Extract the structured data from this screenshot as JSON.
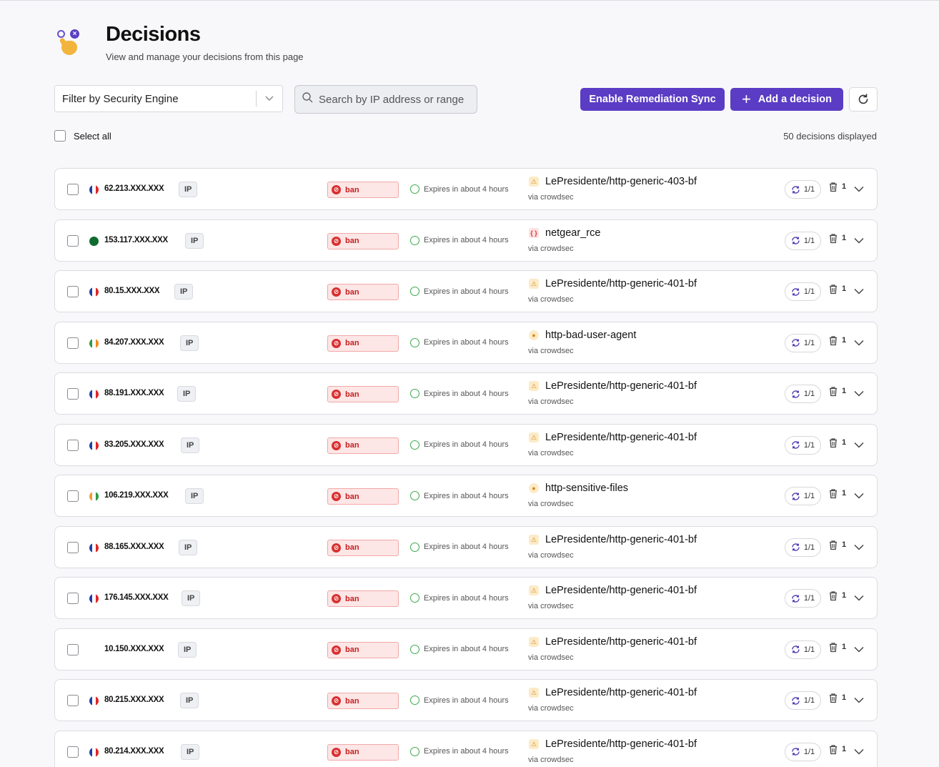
{
  "page": {
    "title": "Decisions",
    "subtitle": "View and manage your decisions from this page"
  },
  "toolbar": {
    "filter_label": "Filter by Security Engine",
    "search_placeholder": "Search by IP address or range",
    "sync_label": "Enable Remediation Sync",
    "add_label": "Add a decision"
  },
  "list": {
    "select_all_label": "Select all",
    "count_label": "50 decisions displayed"
  },
  "colors": {
    "accent": "#5b3cc4",
    "ban_bg": "#fde6e6",
    "ban_text": "#c42020",
    "expires_ring": "#3aaa4a"
  },
  "decisions": [
    {
      "country": "fr",
      "ip": "62.213.XXX.XXX",
      "type": "IP",
      "action": "ban",
      "expires": "Expires in about 4 hours",
      "scenario_icon": "bf",
      "scenario": "LePresidente/http-generic-403-bf",
      "via": "via crowdsec",
      "sync": "1/1",
      "count": "1"
    },
    {
      "country": "pk",
      "ip": "153.117.XXX.XXX",
      "type": "IP",
      "action": "ban",
      "expires": "Expires in about 4 hours",
      "scenario_icon": "rce",
      "scenario": "netgear_rce",
      "via": "via crowdsec",
      "sync": "1/1",
      "count": "1"
    },
    {
      "country": "fr",
      "ip": "80.15.XXX.XXX",
      "type": "IP",
      "action": "ban",
      "expires": "Expires in about 4 hours",
      "scenario_icon": "bf",
      "scenario": "LePresidente/http-generic-401-bf",
      "via": "via crowdsec",
      "sync": "1/1",
      "count": "1"
    },
    {
      "country": "ie",
      "ip": "84.207.XXX.XXX",
      "type": "IP",
      "action": "ban",
      "expires": "Expires in about 4 hours",
      "scenario_icon": "ua",
      "scenario": "http-bad-user-agent",
      "via": "via crowdsec",
      "sync": "1/1",
      "count": "1"
    },
    {
      "country": "fr",
      "ip": "88.191.XXX.XXX",
      "type": "IP",
      "action": "ban",
      "expires": "Expires in about 4 hours",
      "scenario_icon": "bf",
      "scenario": "LePresidente/http-generic-401-bf",
      "via": "via crowdsec",
      "sync": "1/1",
      "count": "1"
    },
    {
      "country": "fr",
      "ip": "83.205.XXX.XXX",
      "type": "IP",
      "action": "ban",
      "expires": "Expires in about 4 hours",
      "scenario_icon": "bf",
      "scenario": "LePresidente/http-generic-401-bf",
      "via": "via crowdsec",
      "sync": "1/1",
      "count": "1"
    },
    {
      "country": "in",
      "ip": "106.219.XXX.XXX",
      "type": "IP",
      "action": "ban",
      "expires": "Expires in about 4 hours",
      "scenario_icon": "ua",
      "scenario": "http-sensitive-files",
      "via": "via crowdsec",
      "sync": "1/1",
      "count": "1"
    },
    {
      "country": "fr",
      "ip": "88.165.XXX.XXX",
      "type": "IP",
      "action": "ban",
      "expires": "Expires in about 4 hours",
      "scenario_icon": "bf",
      "scenario": "LePresidente/http-generic-401-bf",
      "via": "via crowdsec",
      "sync": "1/1",
      "count": "1"
    },
    {
      "country": "fr",
      "ip": "176.145.XXX.XXX",
      "type": "IP",
      "action": "ban",
      "expires": "Expires in about 4 hours",
      "scenario_icon": "bf",
      "scenario": "LePresidente/http-generic-401-bf",
      "via": "via crowdsec",
      "sync": "1/1",
      "count": "1"
    },
    {
      "country": "none",
      "ip": "10.150.XXX.XXX",
      "type": "IP",
      "action": "ban",
      "expires": "Expires in about 4 hours",
      "scenario_icon": "bf",
      "scenario": "LePresidente/http-generic-401-bf",
      "via": "via crowdsec",
      "sync": "1/1",
      "count": "1"
    },
    {
      "country": "fr",
      "ip": "80.215.XXX.XXX",
      "type": "IP",
      "action": "ban",
      "expires": "Expires in about 4 hours",
      "scenario_icon": "bf",
      "scenario": "LePresidente/http-generic-401-bf",
      "via": "via crowdsec",
      "sync": "1/1",
      "count": "1"
    },
    {
      "country": "fr",
      "ip": "80.214.XXX.XXX",
      "type": "IP",
      "action": "ban",
      "expires": "Expires in about 4 hours",
      "scenario_icon": "bf",
      "scenario": "LePresidente/http-generic-401-bf",
      "via": "via crowdsec",
      "sync": "1/1",
      "count": "1"
    }
  ]
}
